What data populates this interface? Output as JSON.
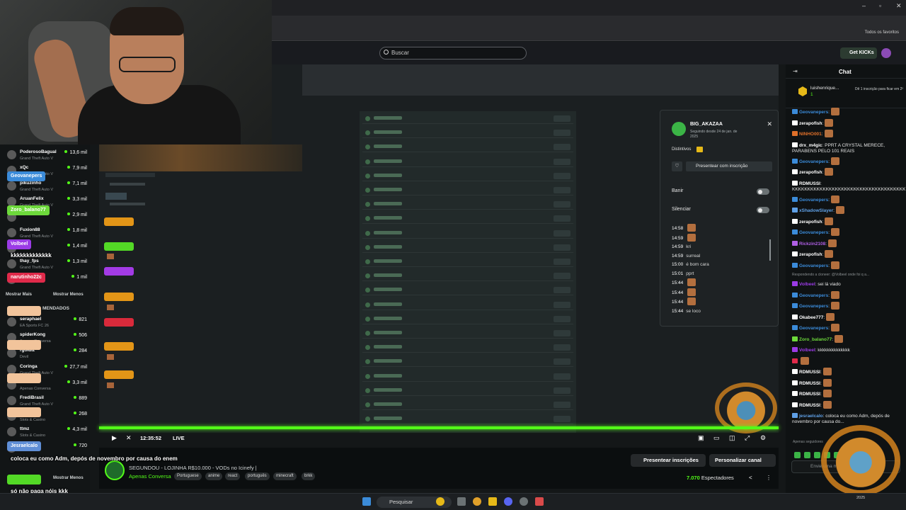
{
  "browser": {
    "bookmarks_label": "Todos os favoritos"
  },
  "header": {
    "search_placeholder": "Buscar",
    "get_kicks": "Get KICKs"
  },
  "sidebar": {
    "channels": [
      {
        "name": "PoderosoBagual",
        "game": "Grand Theft Auto V",
        "count": "13,6 mil"
      },
      {
        "name": "xQc",
        "game": "Grand Theft Auto V",
        "count": "7,9 mil"
      },
      {
        "name": "pikuzinho",
        "game": "Grand Theft Auto V",
        "count": "7,1 mil"
      },
      {
        "name": "AruanFelix",
        "game": "Grand Theft Auto V",
        "count": "3,3 mil"
      },
      {
        "name": "",
        "game": "",
        "count": "2,9 mil"
      },
      {
        "name": "Fuxion88",
        "game": "Grand Theft Auto V",
        "count": "1,8 mil"
      },
      {
        "name": "",
        "game": "",
        "count": "1,4 mil"
      },
      {
        "name": "thay_fps",
        "game": "Grand Theft Auto V",
        "count": "1,3 mil"
      },
      {
        "name": "",
        "game": "",
        "count": "1 mil"
      }
    ],
    "show_more": "Mostrar Mais",
    "show_less": "Mostrar Menos",
    "recommended_title": "MENDADOS",
    "recommended": [
      {
        "name": "seraphael",
        "game": "EA Sports FC 26",
        "count": "821"
      },
      {
        "name": "spiderKong",
        "game": "Apenas Conversa",
        "count": "506"
      },
      {
        "name": "rgoluiz",
        "game": "Devil",
        "count": "284"
      },
      {
        "name": "Coringa",
        "game": "Grand Theft Auto V",
        "count": "27,7 mil"
      },
      {
        "name": "",
        "game": "Apenas Conversa",
        "count": "3,3 mil"
      },
      {
        "name": "FrediBrasil",
        "game": "Grand Theft Auto V",
        "count": "889"
      },
      {
        "name": "",
        "game": "Slots & Casino",
        "count": "268"
      },
      {
        "name": "ttmz",
        "game": "Slots & Casino",
        "count": "4,3 mil"
      },
      {
        "name": "",
        "game": "",
        "count": "720"
      }
    ],
    "show_more_2": "Mostrar Menos"
  },
  "overlay": {
    "bubbles": [
      {
        "name": "Geovanepers",
        "color": "#3b8bd9"
      },
      {
        "name": "Zoro_balano77",
        "color": "#6dd93b"
      },
      {
        "name": "Volbeel",
        "color": "#9b3be6"
      },
      {
        "name": "narutinho22c",
        "color": "#e02a4a"
      },
      {
        "name": "Jesraelcalo",
        "color": "#5f8ed6"
      }
    ],
    "msg_k": "kkkkkkkkkkkkk",
    "msg_adm": "coloca eu como Adm, depós de novembro por causa do enem",
    "msg_paga": "só não paga nóis kkk"
  },
  "player": {
    "time": "12:35:52",
    "live": "LIVE"
  },
  "popup": {
    "username": "BIG_AKAZAA",
    "following": "Seguindo desde 24 de jan. de 2025",
    "distinctives": "Distintivos",
    "gift_sub": "Presentear com inscrição",
    "ban": "Banir",
    "mute": "Silenciar",
    "log": [
      {
        "t": "14:58",
        "m": ""
      },
      {
        "t": "14:59",
        "m": ""
      },
      {
        "t": "14:59",
        "m": "kri"
      },
      {
        "t": "14:59",
        "m": "surreal"
      },
      {
        "t": "15:00",
        "m": "é bom cara"
      },
      {
        "t": "15:01",
        "m": "pprt"
      },
      {
        "t": "15:44",
        "m": ""
      },
      {
        "t": "15:44",
        "m": ""
      },
      {
        "t": "15:44",
        "m": ""
      },
      {
        "t": "15:44",
        "m": "se loco"
      }
    ]
  },
  "stream_info": {
    "title": "SEGUNDOU - LOJINHA R$10.000 - VODs no Icinefy |",
    "category": "Apenas Conversa",
    "tags": [
      "Portuguese",
      "anime",
      "react",
      "português",
      "minecraft",
      "brkk"
    ],
    "gift_subs_button": "Presentear inscrições",
    "customize_button": "Personalizar canal",
    "viewers_count": "7.070",
    "viewers_label": "Espectadores"
  },
  "chat": {
    "title": "Chat",
    "pinned_user": "luishenrique...",
    "pinned_sub": "1",
    "pinned_text": "Dê 1 inscrição para ficar em 2º",
    "messages": [
      {
        "user": "Geovanepers",
        "color": "#3b8bd9",
        "text": ":",
        "emote": true
      },
      {
        "user": "zerapofish",
        "color": "#ffffff",
        "text": ":",
        "emote": true
      },
      {
        "user": "NINHO001",
        "color": "#e0702a",
        "text": ":",
        "emote": true
      },
      {
        "user": "drx_m4gic",
        "color": "#ffffff",
        "text": ": PPRT A CRYSTAL MERECE, PARABENS PELO 101 REAIS",
        "wrap": true
      },
      {
        "user": "Geovanepers",
        "color": "#3b8bd9",
        "text": ":",
        "emote": true
      },
      {
        "user": "zerapofish",
        "color": "#ffffff",
        "text": ":",
        "emote": true
      },
      {
        "user": "RDMUSSI",
        "color": "#ffffff",
        "text": ": KKKKKKKKKKKKKKKKKKKKKKKKKKKKKKKKKKKKKKKKKKKKKKKKKKK",
        "wrap": true
      },
      {
        "user": "Geovanepers",
        "color": "#3b8bd9",
        "text": ":",
        "emote": true
      },
      {
        "user": "xShadowSlayer",
        "color": "#5fa0e6",
        "text": ":",
        "emote": true
      },
      {
        "user": "zerapofish",
        "color": "#ffffff",
        "text": ":",
        "emote": true
      },
      {
        "user": "Geovanepers",
        "color": "#3b8bd9",
        "text": ":",
        "emote": true
      },
      {
        "user": "Rickzin2108",
        "color": "#b05fe6",
        "text": ":",
        "emote": true
      },
      {
        "user": "zerapofish",
        "color": "#ffffff",
        "text": ":",
        "emote": true
      },
      {
        "user": "Geovanepers",
        "color": "#3b8bd9",
        "text": ":",
        "emote": true
      },
      {
        "user": "",
        "color": "#8a8f91",
        "text": "Respondendo a cloneer: @Volbeel onde foi q a...",
        "reply": true
      },
      {
        "user": "Volbeel",
        "color": "#9b3be6",
        "text": ": sei lá viado"
      },
      {
        "user": "Geovanepers",
        "color": "#3b8bd9",
        "text": ":",
        "emote": true
      },
      {
        "user": "Geovanepers",
        "color": "#3b8bd9",
        "text": ":",
        "emote": true
      },
      {
        "user": "Okabee777",
        "color": "#ffffff",
        "text": ":",
        "emote": true
      },
      {
        "user": "Geovanepers",
        "color": "#3b8bd9",
        "text": ":",
        "emote": true
      },
      {
        "user": "Zoro_balano77",
        "color": "#6dd93b",
        "text": ":",
        "emote": true
      },
      {
        "user": "Volbeel",
        "color": "#9b3be6",
        "text": ": kkkkkkkkkkkkkk"
      },
      {
        "user": "",
        "color": "#e02a4a",
        "text": "",
        "emote": true
      },
      {
        "user": "RDMUSSI",
        "color": "#ffffff",
        "text": ":",
        "emote": true
      },
      {
        "user": "RDMUSSI",
        "color": "#ffffff",
        "text": ":",
        "emote": true
      },
      {
        "user": "RDMUSSI",
        "color": "#ffffff",
        "text": ":",
        "emote": true
      },
      {
        "user": "RDMUSSI",
        "color": "#ffffff",
        "text": ":",
        "emote": true
      },
      {
        "user": "jesraelcalo",
        "color": "#5fa0e6",
        "text": ": coloca eu como Adm, depós de novembro por causa do...",
        "wrap": true
      }
    ],
    "followers_only": "Apenas seguidores",
    "input_placeholder": "Envie uma mensagem"
  },
  "taskbar": {
    "search": "Pesquisar",
    "date": "2025"
  }
}
